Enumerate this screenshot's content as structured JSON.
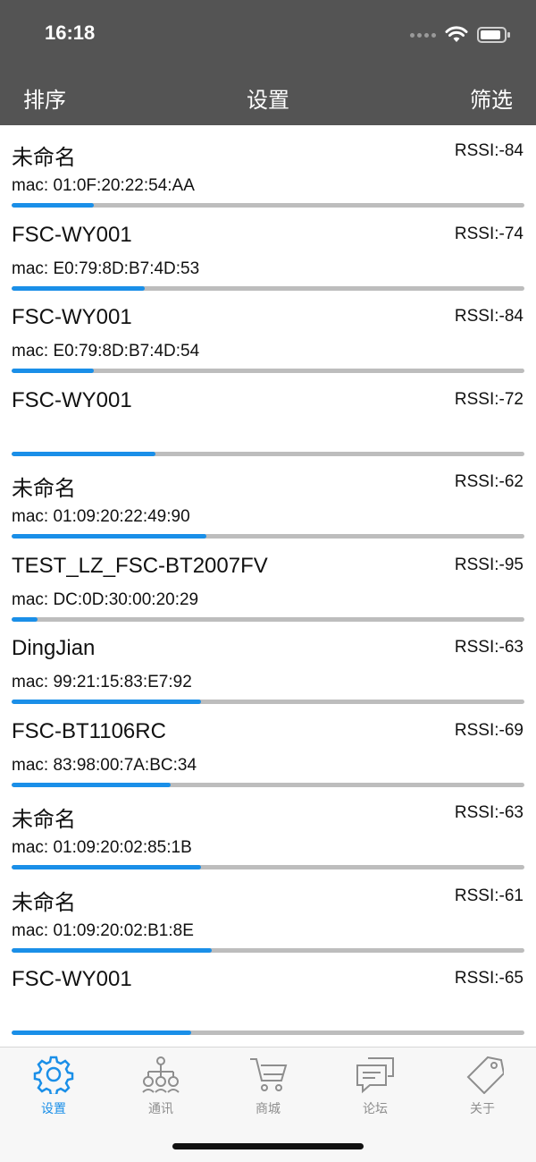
{
  "status_bar": {
    "time": "16:18"
  },
  "nav": {
    "left": "排序",
    "title": "设置",
    "right": "筛选"
  },
  "devices": [
    {
      "name": "未命名",
      "rssi": "RSSI:-84",
      "mac": "mac: 01:0F:20:22:54:AA",
      "signal": 0.16
    },
    {
      "name": "FSC-WY001",
      "rssi": "RSSI:-74",
      "mac": "mac: E0:79:8D:B7:4D:53",
      "signal": 0.26
    },
    {
      "name": "FSC-WY001",
      "rssi": "RSSI:-84",
      "mac": "mac: E0:79:8D:B7:4D:54",
      "signal": 0.16
    },
    {
      "name": "FSC-WY001",
      "rssi": "RSSI:-72",
      "mac": "",
      "signal": 0.28
    },
    {
      "name": "未命名",
      "rssi": "RSSI:-62",
      "mac": "mac: 01:09:20:22:49:90",
      "signal": 0.38
    },
    {
      "name": "TEST_LZ_FSC-BT2007FV",
      "rssi": "RSSI:-95",
      "mac": "mac: DC:0D:30:00:20:29",
      "signal": 0.05
    },
    {
      "name": "DingJian",
      "rssi": "RSSI:-63",
      "mac": "mac: 99:21:15:83:E7:92",
      "signal": 0.37
    },
    {
      "name": "FSC-BT1106RC",
      "rssi": "RSSI:-69",
      "mac": "mac: 83:98:00:7A:BC:34",
      "signal": 0.31
    },
    {
      "name": "未命名",
      "rssi": "RSSI:-63",
      "mac": "mac: 01:09:20:02:85:1B",
      "signal": 0.37
    },
    {
      "name": "未命名",
      "rssi": "RSSI:-61",
      "mac": "mac: 01:09:20:02:B1:8E",
      "signal": 0.39
    },
    {
      "name": "FSC-WY001",
      "rssi": "RSSI:-65",
      "mac": "",
      "signal": 0.35
    }
  ],
  "tabbar": {
    "active_color": "#1a8fe8",
    "tabs": [
      {
        "label": "设置",
        "icon": "gear-icon",
        "active": true
      },
      {
        "label": "通讯",
        "icon": "network-tree-icon",
        "active": false
      },
      {
        "label": "商城",
        "icon": "cart-icon",
        "active": false
      },
      {
        "label": "论坛",
        "icon": "chat-bubbles-icon",
        "active": false
      },
      {
        "label": "关于",
        "icon": "tag-icon",
        "active": false
      }
    ]
  }
}
